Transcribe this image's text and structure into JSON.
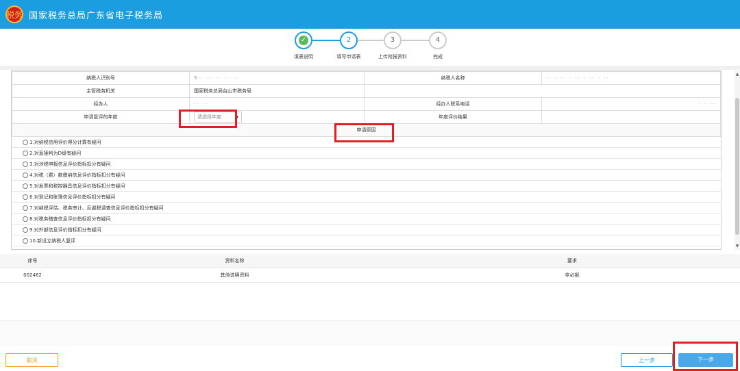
{
  "header": {
    "logo_text": "税务",
    "title": "国家税务总局广东省电子税务局"
  },
  "steps": [
    {
      "label": "填表说明",
      "number": "1",
      "state": "done"
    },
    {
      "label": "填写申请表",
      "number": "2",
      "state": "active"
    },
    {
      "label": "上传附报资料",
      "number": "3",
      "state": "pending"
    },
    {
      "label": "完成",
      "number": "4",
      "state": "pending"
    }
  ],
  "form": {
    "taxpayer_id_label": "纳税人识别号",
    "taxpayer_id_value": "9·· ·· ·· ·· ··",
    "taxpayer_name_label": "纳税人名称",
    "taxpayer_name_value": "·· · ·· · ·· · ·· · ··",
    "authority_label": "主管税务机关",
    "authority_value": "国家税务总局台山市税务局",
    "agent_label": "经办人",
    "agent_value": "·· ··",
    "agent_phone_label": "经办人联系电话",
    "agent_phone_value": "· · ··",
    "year_label": "申请复评的年度",
    "year_placeholder": "请选择年度",
    "result_label": "年度评价结果",
    "reason_label": "申请原因"
  },
  "reasons": [
    "1.对纳税信用评价得分计算有疑问",
    "2.对直接判为D级有疑问",
    "3.对涉税申报信息评价指标扣分有疑问",
    "4.对税（费）款缴纳信息评价指标扣分有疑问",
    "5.对发票和税控器具信息评价指标扣分有疑问",
    "6.对登记和账簿信息评价指标扣分有疑问",
    "7.对纳税评估、税务审计、反避税调查信息评价指标扣分有疑问",
    "8.对税务稽查信息评价指标扣分有疑问",
    "9.对外部信息评价指标扣分有疑问",
    "10.新设立纳税人复评"
  ],
  "docs": {
    "headers": [
      "序号",
      "资料名称",
      "要求"
    ],
    "rows": [
      {
        "no": "002462",
        "name": "其他说明资料",
        "req": "非必报"
      }
    ]
  },
  "buttons": {
    "cancel": "取消",
    "prev": "上一步",
    "next": "下一步"
  },
  "colors": {
    "primary": "#1a9ee0",
    "highlight": "#e02020",
    "cancel": "#f0a030"
  }
}
